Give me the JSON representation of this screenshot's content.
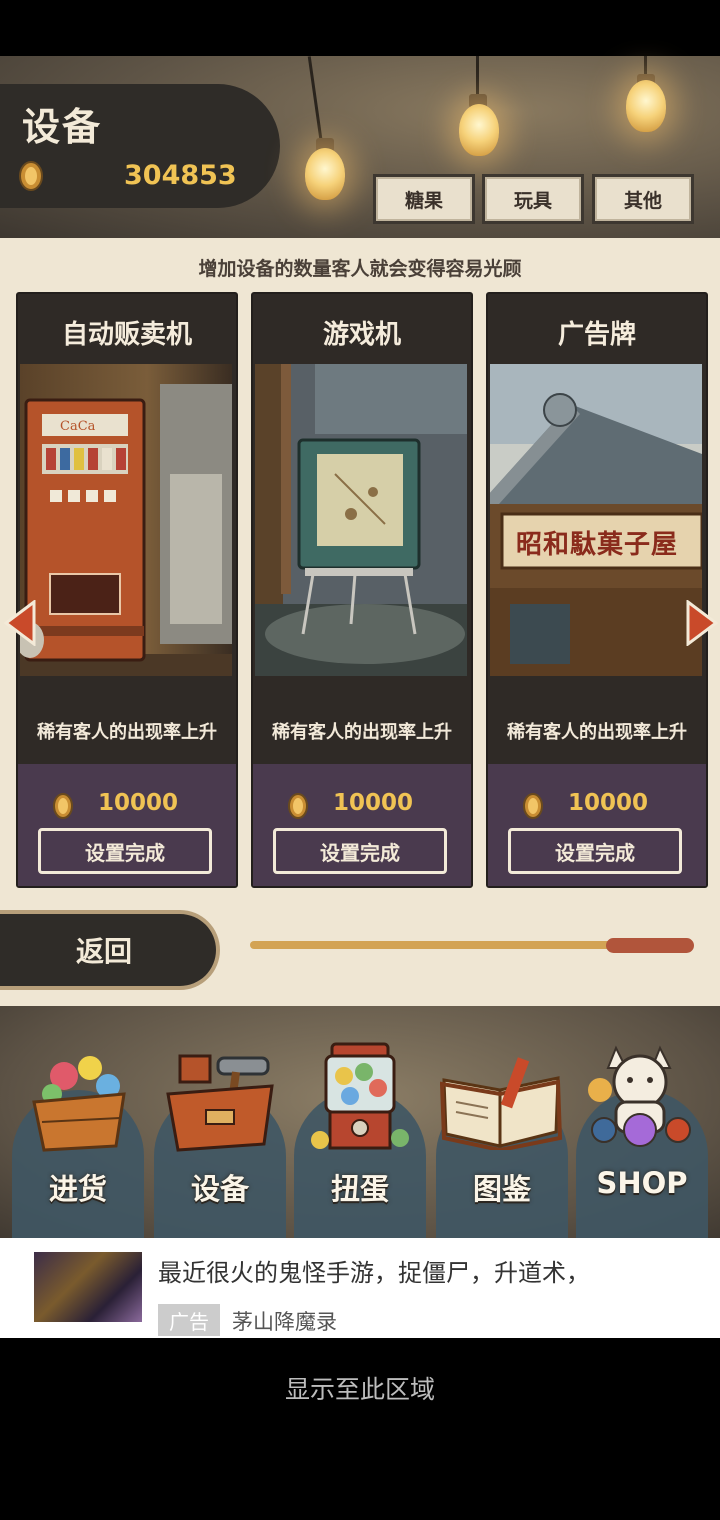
{
  "header": {
    "title": "设备",
    "money": "304853",
    "tabs": [
      "糖果",
      "玩具",
      "其他"
    ]
  },
  "hint": "增加设备的数量客人就会变得容易光顾",
  "cards": [
    {
      "name": "自动贩卖机",
      "desc": "稀有客人的出现率上升",
      "price": "10000",
      "button": "设置完成",
      "image": "vending-machine"
    },
    {
      "name": "游戏机",
      "desc": "稀有客人的出现率上升",
      "price": "10000",
      "button": "设置完成",
      "image": "arcade-machine"
    },
    {
      "name": "广告牌",
      "desc": "稀有客人的出现率上升",
      "price": "10000",
      "button": "设置完成",
      "image": "shop-signboard",
      "sign_text": "昭和駄菓子屋"
    }
  ],
  "back_label": "返回",
  "scroll": {
    "thumb_fraction": 0.2,
    "position": 1.0
  },
  "nav": [
    {
      "label": "进货",
      "icon": "candy-basket-icon"
    },
    {
      "label": "设备",
      "icon": "toolbox-icon"
    },
    {
      "label": "扭蛋",
      "icon": "gacha-machine-icon"
    },
    {
      "label": "图鉴",
      "icon": "book-icon"
    },
    {
      "label": "SHOP",
      "icon": "lucky-cat-icon"
    }
  ],
  "ad": {
    "text": "最近很火的鬼怪手游，捉僵尸，升道术，",
    "badge": "广告",
    "source": "茅山降魔录"
  },
  "footer": "显示至此区域",
  "colors": {
    "accent_gold": "#f0c354",
    "card_dark": "#2f2a26",
    "card_purple": "#4a3a4e",
    "progress": "#d3a354",
    "thumb": "#b1553b"
  }
}
